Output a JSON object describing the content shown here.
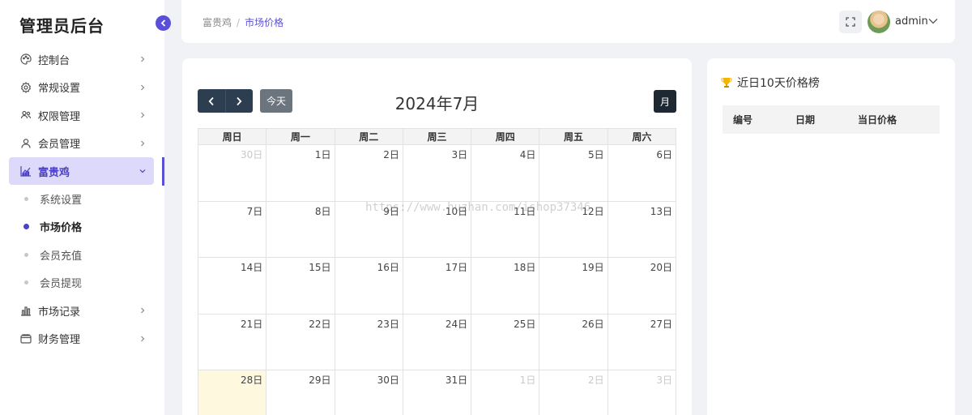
{
  "sidebar": {
    "brand": "管理员后台",
    "menu": [
      {
        "label": "控制台",
        "icon": "palette-icon"
      },
      {
        "label": "常规设置",
        "icon": "gear-icon"
      },
      {
        "label": "权限管理",
        "icon": "users-icon"
      },
      {
        "label": "会员管理",
        "icon": "user-icon"
      },
      {
        "label": "富贵鸡",
        "icon": "chart-area-icon",
        "active": true
      }
    ],
    "submenu": [
      {
        "label": "系统设置"
      },
      {
        "label": "市场价格",
        "current": true
      },
      {
        "label": "会员充值"
      },
      {
        "label": "会员提现"
      }
    ],
    "menu_after": [
      {
        "label": "市场记录",
        "icon": "bar-chart-icon"
      },
      {
        "label": "财务管理",
        "icon": "wallet-icon"
      }
    ]
  },
  "header": {
    "breadcrumb": [
      "富贵鸡",
      "市场价格"
    ],
    "username": "admin"
  },
  "calendar": {
    "title": "2024年7月",
    "today_label": "今天",
    "month_label": "月",
    "weekdays": [
      "周日",
      "周一",
      "周二",
      "周三",
      "周四",
      "周五",
      "周六"
    ],
    "weeks": [
      [
        {
          "d": "30日",
          "o": true
        },
        {
          "d": "1日"
        },
        {
          "d": "2日"
        },
        {
          "d": "3日"
        },
        {
          "d": "4日"
        },
        {
          "d": "5日"
        },
        {
          "d": "6日"
        }
      ],
      [
        {
          "d": "7日"
        },
        {
          "d": "8日"
        },
        {
          "d": "9日"
        },
        {
          "d": "10日"
        },
        {
          "d": "11日"
        },
        {
          "d": "12日"
        },
        {
          "d": "13日"
        }
      ],
      [
        {
          "d": "14日"
        },
        {
          "d": "15日"
        },
        {
          "d": "16日"
        },
        {
          "d": "17日"
        },
        {
          "d": "18日"
        },
        {
          "d": "19日"
        },
        {
          "d": "20日"
        }
      ],
      [
        {
          "d": "21日"
        },
        {
          "d": "22日"
        },
        {
          "d": "23日"
        },
        {
          "d": "24日"
        },
        {
          "d": "25日"
        },
        {
          "d": "26日"
        },
        {
          "d": "27日"
        }
      ],
      [
        {
          "d": "28日",
          "t": true
        },
        {
          "d": "29日"
        },
        {
          "d": "30日"
        },
        {
          "d": "31日"
        },
        {
          "d": "1日",
          "o": true
        },
        {
          "d": "2日",
          "o": true
        },
        {
          "d": "3日",
          "o": true
        }
      ]
    ]
  },
  "ranking": {
    "title": "近日10天价格榜",
    "columns": [
      "编号",
      "日期",
      "当日价格"
    ]
  },
  "watermark": "https://www.huzhan.com/ishop37346",
  "colors": {
    "accent": "#5a4fd6",
    "active_bg": "#dcd9fb",
    "today_cell": "#fdf8de",
    "nav_dark": "#2c3e50"
  }
}
